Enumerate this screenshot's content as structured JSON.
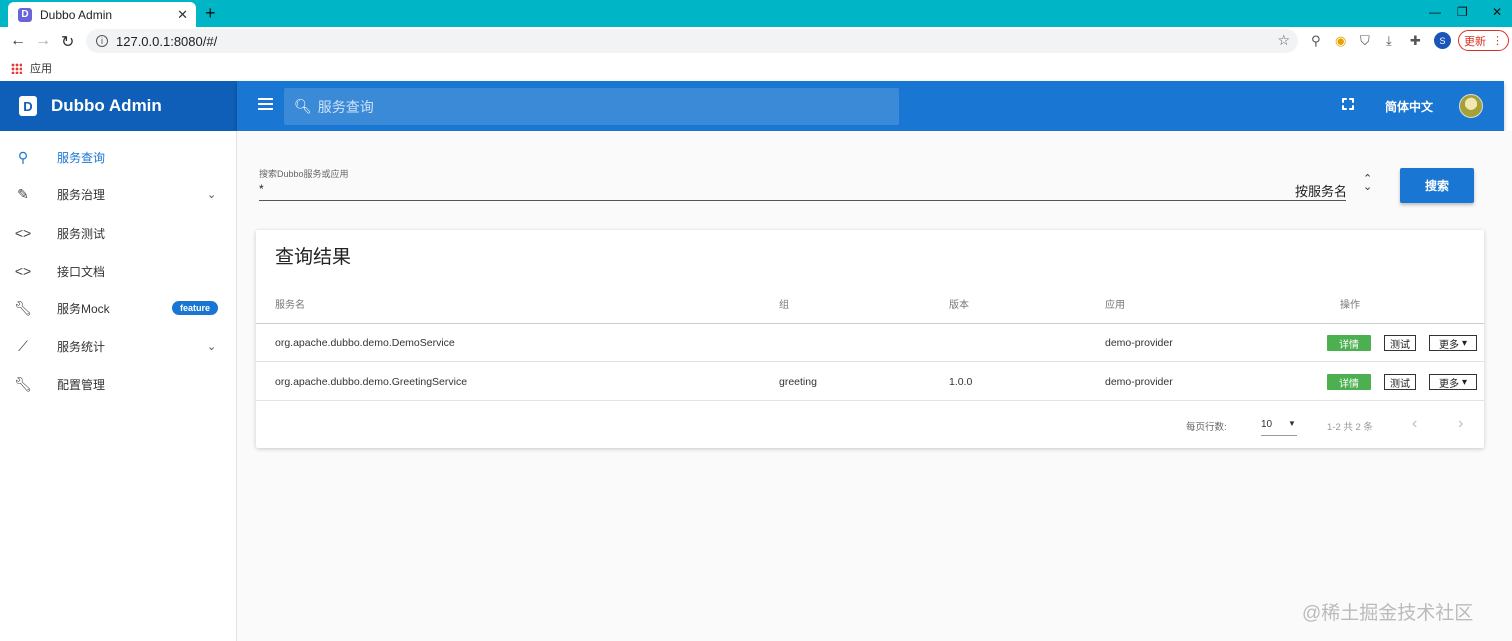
{
  "browser": {
    "tab_title": "Dubbo Admin",
    "url": "127.0.0.1:8080/#/",
    "bookmark_apps": "应用",
    "update_label": "更新",
    "profile_initial": "S"
  },
  "header": {
    "brand_title": "Dubbo Admin",
    "search_placeholder": "服务查询",
    "language": "简体中文"
  },
  "sidebar": {
    "items": [
      {
        "label": "服务查询",
        "icon": "search-icon"
      },
      {
        "label": "服务治理",
        "icon": "pencil-icon"
      },
      {
        "label": "服务测试",
        "icon": "code-icon"
      },
      {
        "label": "接口文档",
        "icon": "code-icon"
      },
      {
        "label": "服务Mock",
        "icon": "wrench-icon",
        "badge": "feature"
      },
      {
        "label": "服务统计",
        "icon": "trending-icon"
      },
      {
        "label": "配置管理",
        "icon": "wrench-icon"
      }
    ]
  },
  "search": {
    "label": "搜索Dubbo服务或应用",
    "value": "*",
    "sort_by": "按服务名",
    "button": "搜索"
  },
  "results": {
    "title": "查询结果",
    "columns": [
      "服务名",
      "组",
      "版本",
      "应用",
      "操作"
    ],
    "rows": [
      {
        "service": "org.apache.dubbo.demo.DemoService",
        "group": "",
        "version": "",
        "app": "demo-provider"
      },
      {
        "service": "org.apache.dubbo.demo.GreetingService",
        "group": "greeting",
        "version": "1.0.0",
        "app": "demo-provider"
      }
    ],
    "actions": {
      "detail": "详情",
      "test": "测试",
      "more": "更多"
    },
    "footer": {
      "rows_per_page_label": "每页行数:",
      "rows_per_page": "10",
      "range": "1-2 共 2 条"
    }
  },
  "watermark": "@稀土掘金技术社区",
  "colors": {
    "primary": "#1976d2",
    "brand": "#0f5fb8",
    "success": "#4caf50",
    "tabstrip": "#00b6c6"
  }
}
